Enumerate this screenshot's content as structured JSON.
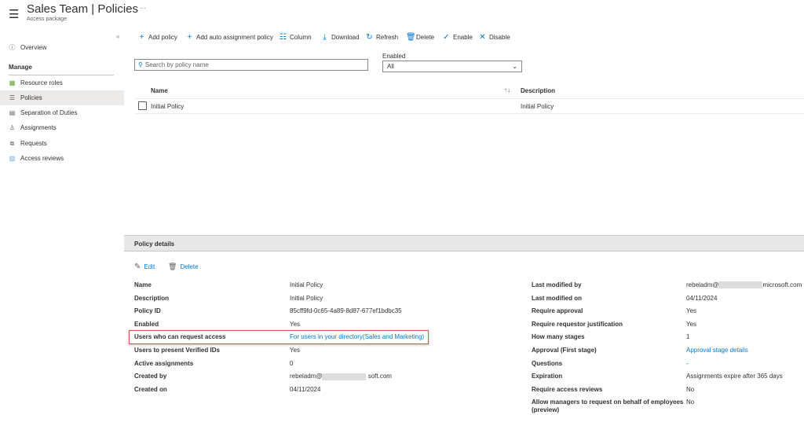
{
  "header": {
    "title": "Sales Team | Policies",
    "subtitle": "Access package",
    "more": "···",
    "collapse": "«"
  },
  "sidebar": {
    "overview": "Overview",
    "section": "Manage",
    "items": [
      {
        "label": "Resource roles",
        "icon": "grid-icon"
      },
      {
        "label": "Policies",
        "icon": "list-icon"
      },
      {
        "label": "Separation of Duties",
        "icon": "clipboard-icon"
      },
      {
        "label": "Assignments",
        "icon": "person-icon"
      },
      {
        "label": "Requests",
        "icon": "requests-icon"
      },
      {
        "label": "Access reviews",
        "icon": "review-icon"
      }
    ],
    "selected": "Policies"
  },
  "toolbar": {
    "add_policy": "Add policy",
    "add_auto": "Add auto assignment policy",
    "column": "Column",
    "download": "Download",
    "refresh": "Refresh",
    "delete": "Delete",
    "enable": "Enable",
    "disable": "Disable"
  },
  "filters": {
    "search_placeholder": "Search by policy name",
    "enabled_label": "Enabled",
    "enabled_value": "All"
  },
  "table": {
    "columns": [
      "Name",
      "Description"
    ],
    "rows": [
      {
        "name": "Initial Policy",
        "description": "Initial Policy"
      }
    ]
  },
  "details": {
    "header": "Policy details",
    "edit": "Edit",
    "delete": "Delete",
    "left": [
      [
        "Name",
        "Initial Policy"
      ],
      [
        "Description",
        "Initial Policy"
      ],
      [
        "Policy ID",
        "85cff9fd-0c65-4a89-8d87-677ef1bdbc35"
      ],
      [
        "Enabled",
        "Yes"
      ],
      [
        "Users who can request access",
        "For users in your directory(Sales and Marketing)"
      ],
      [
        "Users to present Verified IDs",
        "Yes"
      ],
      [
        "Active assignments",
        "0"
      ],
      [
        "Created by",
        "rebeladm@",
        ";;",
        " soft.com"
      ],
      [
        "Created on",
        "04/11/2024"
      ]
    ],
    "right": [
      [
        "Last modified by",
        "rebeladm@",
        "",
        "microsoft.com"
      ],
      [
        "Last modified on",
        "04/11/2024"
      ],
      [
        "Require approval",
        "Yes"
      ],
      [
        "Require requestor justification",
        "Yes"
      ],
      [
        "How many stages",
        "1"
      ],
      [
        "Approval (First stage)",
        "Approval stage details"
      ],
      [
        "Questions",
        "-"
      ],
      [
        "Expiration",
        "Assignments expire after 365 days"
      ],
      [
        "Require access reviews",
        "No"
      ],
      [
        "Allow managers to request on behalf of employees",
        "No"
      ]
    ],
    "right_last_label_cont": "(preview)"
  },
  "colors": {
    "accent": "#0078d4",
    "highlight_box": "#e74c4c",
    "panel_header": "#e8e8e8"
  }
}
